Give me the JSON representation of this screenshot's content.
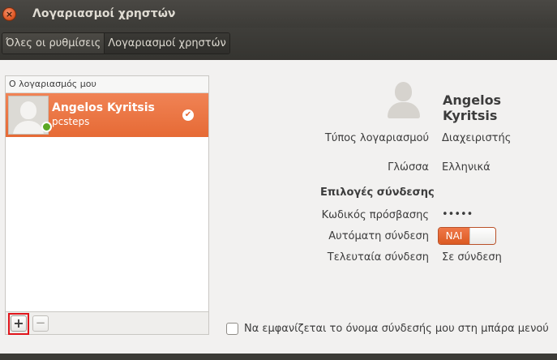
{
  "window": {
    "title": "Λογαριασμοί χρηστών",
    "close_glyph": "×"
  },
  "breadcrumb": {
    "items": [
      "Όλες οι ρυθμίσεις",
      "Λογαριασμοί χρηστών"
    ]
  },
  "account_list": {
    "header": "Ο λογαριασμός μου",
    "selected": {
      "name": "Angelos Kyritsis",
      "username": "pcsteps",
      "status": "online"
    },
    "add_label": "+",
    "remove_label": "−"
  },
  "details": {
    "name": "Angelos Kyritsis",
    "account_type_label": "Τύπος λογαριασμού",
    "account_type_value": "Διαχειριστής",
    "language_label": "Γλώσσα",
    "language_value": "Ελληνικά",
    "login_options_title": "Επιλογές σύνδεσης",
    "password_label": "Κωδικός πρόσβασης",
    "password_value": "•••••",
    "autologin_label": "Αυτόματη σύνδεση",
    "autologin_value": "ΝΑΙ",
    "last_login_label": "Τελευταία σύνδεση",
    "last_login_value": "Σε σύνδεση"
  },
  "menubar_option": {
    "label": "Να εμφανίζεται το όνομα σύνδεσής μου στη μπάρα μενού",
    "checked": false
  },
  "colors": {
    "accent": "#e66a35",
    "online": "#5aa824",
    "highlight": "#e0141b"
  }
}
